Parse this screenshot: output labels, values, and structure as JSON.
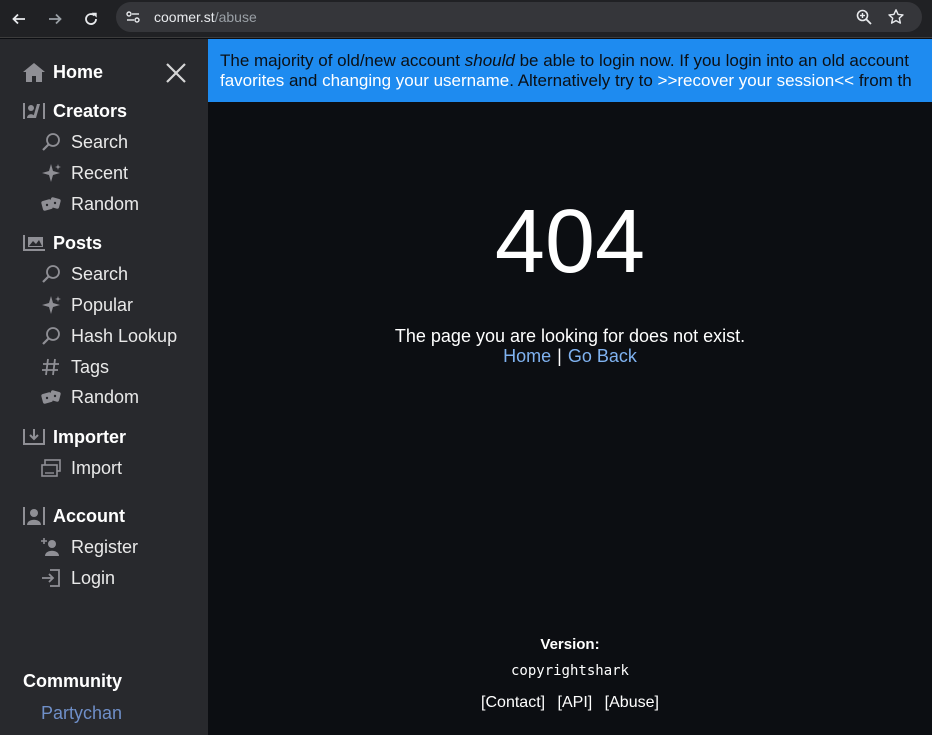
{
  "browser": {
    "url_host": "coomer.st",
    "url_path": "/abuse"
  },
  "sidebar": {
    "home": "Home",
    "creators": {
      "heading": "Creators",
      "items": [
        {
          "label": "Search",
          "icon": "magnifier-icon"
        },
        {
          "label": "Recent",
          "icon": "sparkle-icon"
        },
        {
          "label": "Random",
          "icon": "dice-icon"
        }
      ]
    },
    "posts": {
      "heading": "Posts",
      "items": [
        {
          "label": "Search",
          "icon": "magnifier-icon"
        },
        {
          "label": "Popular",
          "icon": "sparkle-icon"
        },
        {
          "label": "Hash Lookup",
          "icon": "magnifier-icon"
        },
        {
          "label": "Tags",
          "icon": "hash-icon"
        },
        {
          "label": "Random",
          "icon": "dice-icon"
        }
      ]
    },
    "importer": {
      "heading": "Importer",
      "items": [
        {
          "label": "Import",
          "icon": "import-icon"
        }
      ]
    },
    "account": {
      "heading": "Account",
      "items": [
        {
          "label": "Register",
          "icon": "register-icon"
        },
        {
          "label": "Login",
          "icon": "login-icon"
        }
      ]
    },
    "community": {
      "heading": "Community",
      "link": "Partychan"
    }
  },
  "banner": {
    "line1_a": "The majority of old/new account ",
    "line1_em": "should",
    "line1_b": " be able to login now. If you login into an old account",
    "line2_link1": "favorites",
    "line2_mid1": " and ",
    "line2_link2": "changing your username",
    "line2_mid2": ". Alternatively try to ",
    "line2_link3": ">>recover your session<<",
    "line2_tail": " from th"
  },
  "error": {
    "code": "404",
    "message": "The page you are looking for does not exist.",
    "home_link": "Home",
    "separator": "|",
    "back_link": "Go Back"
  },
  "footer": {
    "version_label": "Version:",
    "version_tag": "copyrightshark",
    "links": [
      "[Contact]",
      "[API]",
      "[Abuse]"
    ]
  },
  "colors": {
    "banner_bg": "#1e8bf0",
    "sidebar_bg": "#28292d",
    "main_bg": "#0c0e12",
    "link": "#7fb2f0",
    "community_link": "#6f8fc8"
  }
}
